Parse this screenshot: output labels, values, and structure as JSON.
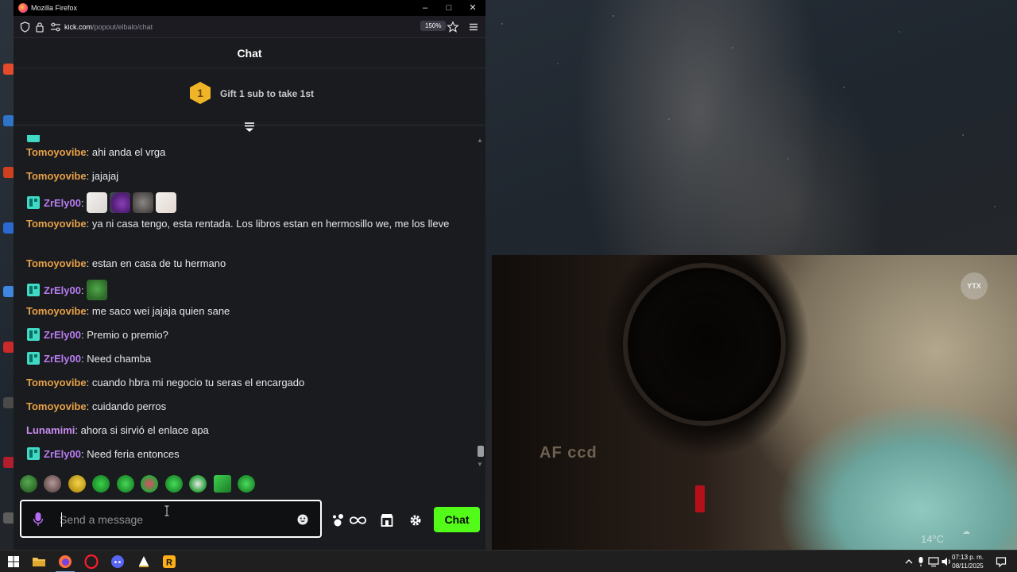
{
  "browser": {
    "window_title": "Mozilla Firefox",
    "url_host": "kick.com",
    "url_path": "/popout/elbalo/chat",
    "zoom": "150%"
  },
  "chat": {
    "header": "Chat",
    "gift_text": "Gift 1 sub to take 1st",
    "gift_rank": "1",
    "messages": [
      {
        "user": "Tomoyovibe",
        "text": "ahi anda el vrga"
      },
      {
        "user": "Tomoyovibe",
        "text": "jajajaj"
      },
      {
        "user": "ZrEly00",
        "text": ""
      },
      {
        "user": "Tomoyovibe",
        "text": "ya ni casa tengo, esta rentada. Los libros estan en hermosillo we, me los lleve"
      },
      {
        "user": "Tomoyovibe",
        "text": "estan en casa de tu hermano"
      },
      {
        "user": "ZrEly00",
        "text": ""
      },
      {
        "user": "Tomoyovibe",
        "text": "me saco wei jajaja quien sane"
      },
      {
        "user": "ZrEly00",
        "text": "Premio o premio?"
      },
      {
        "user": "ZrEly00",
        "text": "Need chamba"
      },
      {
        "user": "Tomoyovibe",
        "text": "cuando hbra mi negocio tu seras el encargado"
      },
      {
        "user": "Tomoyovibe",
        "text": "cuidando perros"
      },
      {
        "user": "Lunamimi",
        "text": "ahora si sirvió el enlace apa"
      },
      {
        "user": "ZrEly00",
        "text": "Need feria entonces"
      }
    ],
    "input_placeholder": "Send a message",
    "send_label": "Chat",
    "accent_color": "#53fc18"
  },
  "video": {
    "overlay_text": "AF ccd",
    "badge_text": "YTX",
    "temperature": "14°C"
  },
  "taskbar": {
    "time": "07:13 p. m.",
    "date": "08/11/2025"
  }
}
